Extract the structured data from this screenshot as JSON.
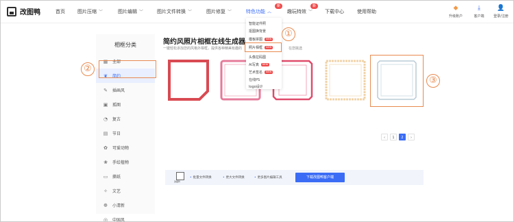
{
  "app": {
    "logo_text": "改图鸭"
  },
  "nav": {
    "items": [
      {
        "label": "首页",
        "has_chevron": false
      },
      {
        "label": "图片压缩",
        "has_chevron": true
      },
      {
        "label": "图片编辑",
        "has_chevron": true
      },
      {
        "label": "图片文件转换",
        "has_chevron": true
      },
      {
        "label": "图片修复",
        "has_chevron": true
      },
      {
        "label": "特色功能",
        "has_chevron": true,
        "active": true,
        "badge": "新"
      },
      {
        "label": "趣玩特效",
        "has_chevron": true,
        "badge": "新"
      },
      {
        "label": "下载中心",
        "has_chevron": false
      },
      {
        "label": "使用帮助",
        "has_chevron": false
      }
    ],
    "utilities": [
      {
        "icon": "diamond-icon",
        "label": "升级账户"
      },
      {
        "icon": "download-icon",
        "label": "客户端"
      },
      {
        "icon": "user-icon",
        "label": "登录/注册"
      }
    ]
  },
  "sidebar": {
    "title": "相框分类",
    "items": [
      {
        "label": "全部",
        "icon": "grid-icon"
      },
      {
        "label": "简约",
        "icon": "leaf-icon",
        "active": true
      },
      {
        "label": "插画风",
        "icon": "brush-icon"
      },
      {
        "label": "孤图",
        "icon": "image-icon"
      },
      {
        "label": "复古",
        "icon": "clock-icon"
      },
      {
        "label": "节日",
        "icon": "calendar-icon"
      },
      {
        "label": "可爱动物",
        "icon": "paw-icon"
      },
      {
        "label": "手绘植物",
        "icon": "plant-icon"
      },
      {
        "label": "撕纸",
        "icon": "paper-icon"
      },
      {
        "label": "文艺",
        "icon": "book-icon"
      },
      {
        "label": "小清新",
        "icon": "flower-icon"
      },
      {
        "label": "中国风",
        "icon": "fan-icon"
      }
    ]
  },
  "main": {
    "title": "简约风照片相框在线生成器",
    "subtitle": "一键轻松添加您的风格外相框，提供各种精美有趣的",
    "subtitle_tail": "在您挑选"
  },
  "dropdown": {
    "items": [
      {
        "label": "智能证件照",
        "badge": ""
      },
      {
        "label": "抠图换背景",
        "badge": ""
      },
      {
        "label": "模板拼图",
        "badge": "NEW"
      },
      {
        "label": "照片相框",
        "badge": "NEW"
      },
      {
        "label": "头像拉码图",
        "badge": ""
      },
      {
        "label": "AI写真",
        "badge": "NEW"
      },
      {
        "label": "艺术签名",
        "badge": "NEW"
      },
      {
        "label": "在线PS",
        "badge": ""
      },
      {
        "label": "logo设计",
        "badge": ""
      }
    ]
  },
  "pager": {
    "prev": "‹",
    "pages": [
      "1",
      "2"
    ],
    "current": "2",
    "next": "›"
  },
  "promo": {
    "icon_label": "改图鸭",
    "features": [
      "批量文件转换",
      "更大文件转换",
      "更多图片编辑工具"
    ],
    "button": "下载改图鸭客户端"
  },
  "annotations": [
    "①",
    "②",
    "③"
  ],
  "colors": {
    "accent": "#3b6cf5",
    "annotation": "#e8894e",
    "badge": "#f04a4a"
  }
}
